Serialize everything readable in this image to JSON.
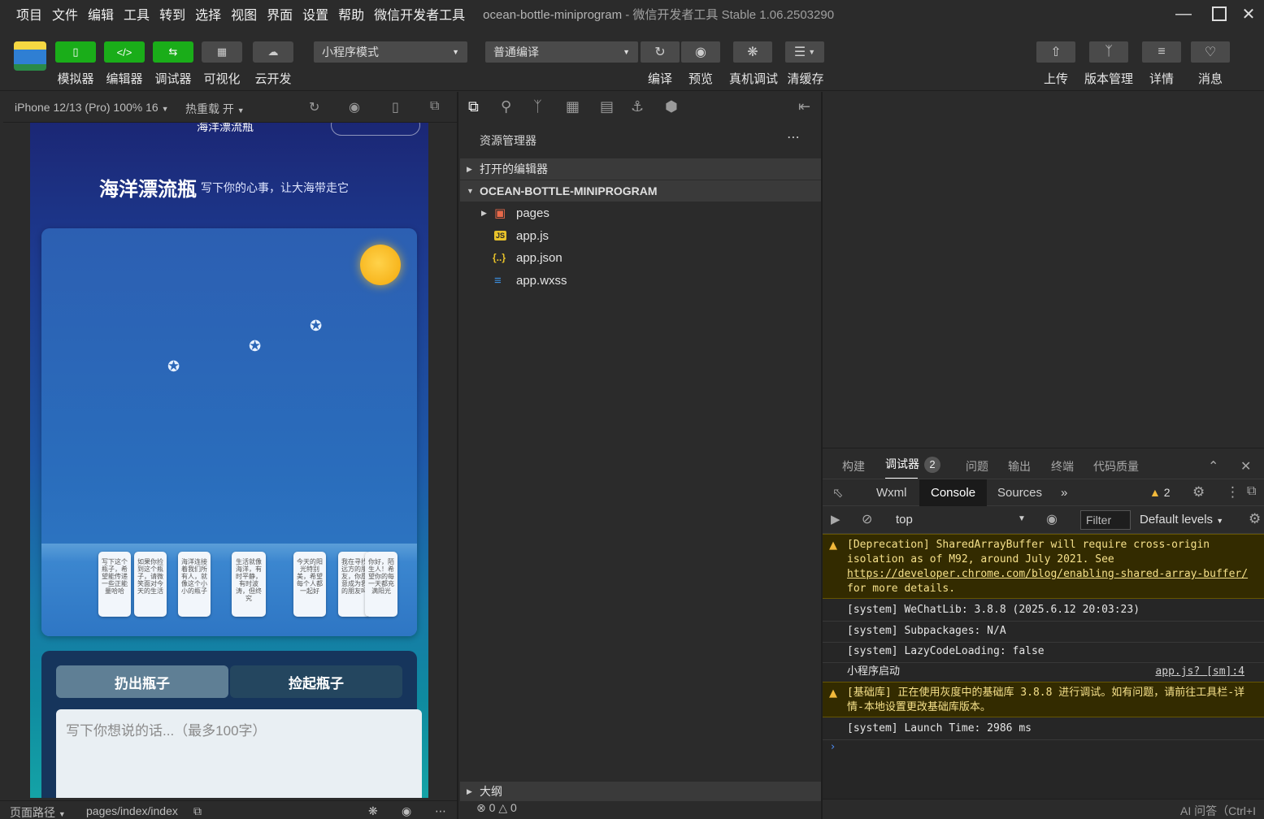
{
  "menubar": {
    "items": [
      "项目",
      "文件",
      "编辑",
      "工具",
      "转到",
      "选择",
      "视图",
      "界面",
      "设置",
      "帮助",
      "微信开发者工具"
    ],
    "project_name": "ocean-bottle-miniprogram",
    "app_title": " - 微信开发者工具 Stable 1.06.2503290"
  },
  "toolbar": {
    "simulator": "模拟器",
    "editor": "编辑器",
    "debugger": "调试器",
    "visual": "可视化",
    "cloud": "云开发",
    "mode_select": "小程序模式",
    "compile_select": "普通编译",
    "compile": "编译",
    "preview": "预览",
    "real_debug": "真机调试",
    "clear_cache": "清缓存",
    "upload": "上传",
    "version": "版本管理",
    "details": "详情",
    "messages": "消息"
  },
  "simulator": {
    "device": "iPhone 12/13 (Pro) 100% 16",
    "hot_reload": "热重载 开",
    "app_header_cut": "海洋漂流瓶",
    "app_title": "海洋漂流瓶",
    "app_subtitle": "写下你的心事，让大海带走它",
    "bottles": [
      "写下这个瓶子，希望能传递一些正能量哈哈",
      "如果你捡到这个瓶子，请微笑面对今天的生活",
      "海洋连接着我们所有人，就像这个小小的瓶子",
      "生活就像海洋，有时平静，有时波涛，但终究",
      "今天的阳光特别美，希望每个人都一起好",
      "我在寻找远方的朋友，你愿意成为我的朋友吗",
      "你好，陌生人！希望你的每一天都充满阳光"
    ],
    "throw_button": "扔出瓶子",
    "pick_button": "捡起瓶子",
    "message_placeholder": "写下你想说的话...（最多100字）",
    "footer_path_label": "页面路径",
    "footer_path": "pages/index/index"
  },
  "explorer": {
    "title": "资源管理器",
    "open_editors": "打开的编辑器",
    "project_root": "OCEAN-BOTTLE-MINIPROGRAM",
    "files": [
      {
        "name": "pages",
        "icon": "folder-icon"
      },
      {
        "name": "app.js",
        "icon": "js-file-icon"
      },
      {
        "name": "app.json",
        "icon": "json-file-icon"
      },
      {
        "name": "app.wxss",
        "icon": "css-file-icon"
      }
    ],
    "outline": "大纲",
    "errors": "0",
    "warnings": "0"
  },
  "debugger": {
    "tabs": [
      "构建",
      "调试器",
      "问题",
      "输出",
      "终端",
      "代码质量"
    ],
    "debugger_badge": "2",
    "dev_tabs": [
      "Wxml",
      "Console",
      "Sources"
    ],
    "warning_count": "2",
    "context": "top",
    "filter_placeholder": "Filter",
    "levels": "Default levels",
    "logs": [
      {
        "type": "warn",
        "text": "[Deprecation] SharedArrayBuffer will require cross-origin isolation as of M92, around July 2021. See ",
        "link": "https://developer.chrome.com/blog/enabling-shared-array-buffer/",
        "tail": " for more details."
      },
      {
        "type": "log",
        "text": "[system] WeChatLib: 3.8.8 (2025.6.12 20:03:23)"
      },
      {
        "type": "log",
        "text": "[system] Subpackages: N/A"
      },
      {
        "type": "log",
        "text": "[system] LazyCodeLoading: false"
      },
      {
        "type": "log",
        "text": "小程序启动",
        "source": "app.js? [sm]:4"
      },
      {
        "type": "warn",
        "text": "[基础库] 正在使用灰度中的基础库 3.8.8 进行调试。如有问题，请前往工具栏-详情-本地设置更改基础库版本。"
      },
      {
        "type": "log",
        "text": "[system] Launch Time: 2986 ms"
      }
    ],
    "footer": "AI 问答（Ctrl+I"
  },
  "colors": {
    "accent_green": "#1aad19",
    "warn_bg": "#332b00",
    "warn_text": "#f5e08a"
  }
}
